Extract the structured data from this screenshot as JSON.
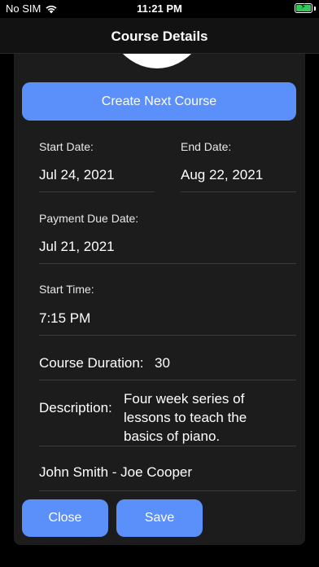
{
  "status_bar": {
    "carrier": "No SIM",
    "time": "11:21 PM"
  },
  "nav": {
    "title": "Course Details"
  },
  "actions": {
    "create_next_course": "Create Next Course",
    "close": "Close",
    "save": "Save"
  },
  "course": {
    "start_date_label": "Start Date:",
    "start_date": "Jul 24, 2021",
    "end_date_label": "End Date:",
    "end_date": "Aug 22, 2021",
    "payment_due_label": "Payment Due Date:",
    "payment_due": "Jul 21, 2021",
    "start_time_label": "Start Time:",
    "start_time": "7:15 PM",
    "duration_label": "Course Duration:",
    "duration": "30",
    "description_label": "Description:",
    "description": "Four week series of lessons to teach the basics of piano.",
    "participants": "John Smith - Joe Cooper"
  },
  "colors": {
    "accent": "#5b8ff9",
    "background": "#000000",
    "card": "#1c1c1c",
    "battery": "#34c759"
  },
  "icons": [
    "wifi-icon",
    "battery-charging-icon"
  ]
}
